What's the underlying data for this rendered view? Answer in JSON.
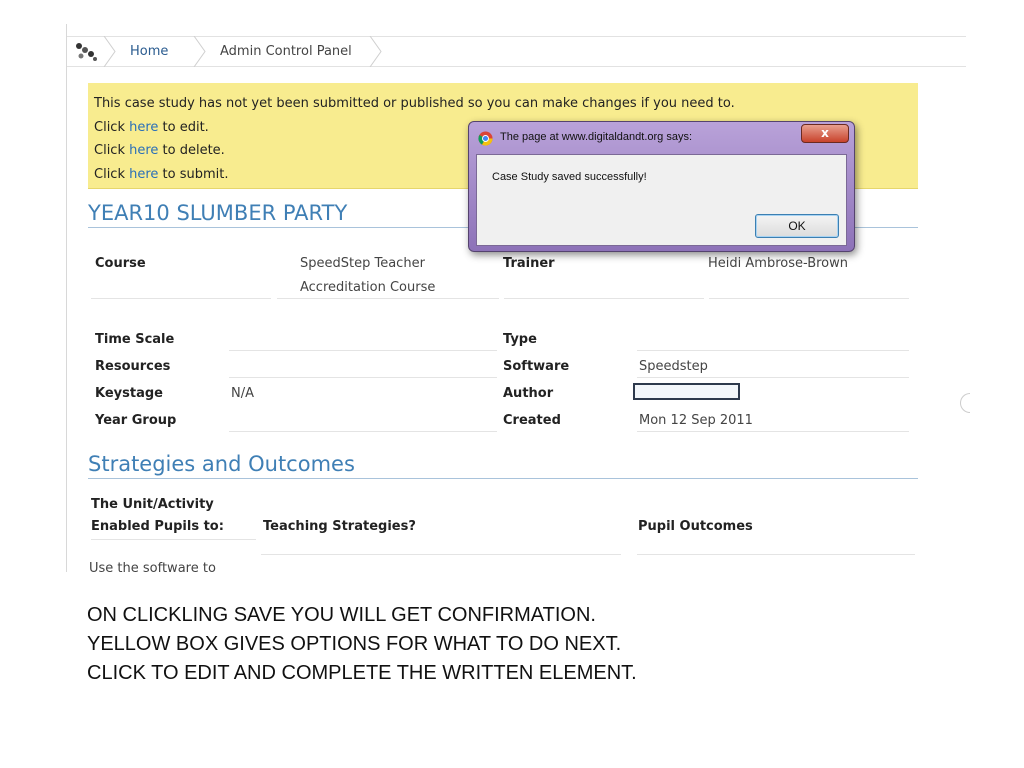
{
  "breadcrumb": {
    "home": "Home",
    "admin": "Admin Control Panel"
  },
  "notice": {
    "message": "This case study has not yet been submitted or published so you can make changes if you need to.",
    "lines": [
      {
        "prefix": "Click ",
        "link": "here",
        "suffix": " to edit."
      },
      {
        "prefix": "Click ",
        "link": "here",
        "suffix": " to delete."
      },
      {
        "prefix": "Click ",
        "link": "here",
        "suffix": " to submit."
      }
    ]
  },
  "case_study": {
    "title": "YEAR10 SLUMBER PARTY",
    "course_label": "Course",
    "course_value_1": "SpeedStep Teacher",
    "course_value_2": "Accreditation Course",
    "trainer_label": "Trainer",
    "trainer_value": "Heidi Ambrose-Brown",
    "time_scale_label": "Time Scale",
    "resources_label": "Resources",
    "keystage_label": "Keystage",
    "keystage_value": "N/A",
    "year_group_label": "Year Group",
    "type_label": "Type",
    "software_label": "Software",
    "software_value": "Speedstep",
    "author_label": "Author",
    "created_label": "Created",
    "created_value": "Mon 12 Sep 2011"
  },
  "strategies": {
    "title": "Strategies and Outcomes",
    "col1_line1": "The Unit/Activity",
    "col1_line2": "Enabled Pupils to:",
    "col2": "Teaching Strategies?",
    "col3": "Pupil Outcomes",
    "first_row_text": "Use the software to"
  },
  "dialog": {
    "title": "The page at www.digitaldandt.org says:",
    "close": "x",
    "message": "Case Study saved successfully!",
    "ok": "OK"
  },
  "caption": {
    "line1": "ON CLICKLING SAVE YOU WILL GET CONFIRMATION.",
    "line2": "YELLOW BOX GIVES OPTIONS FOR WHAT TO DO NEXT.",
    "line3": "CLICK TO EDIT AND COMPLETE THE WRITTEN ELEMENT."
  }
}
